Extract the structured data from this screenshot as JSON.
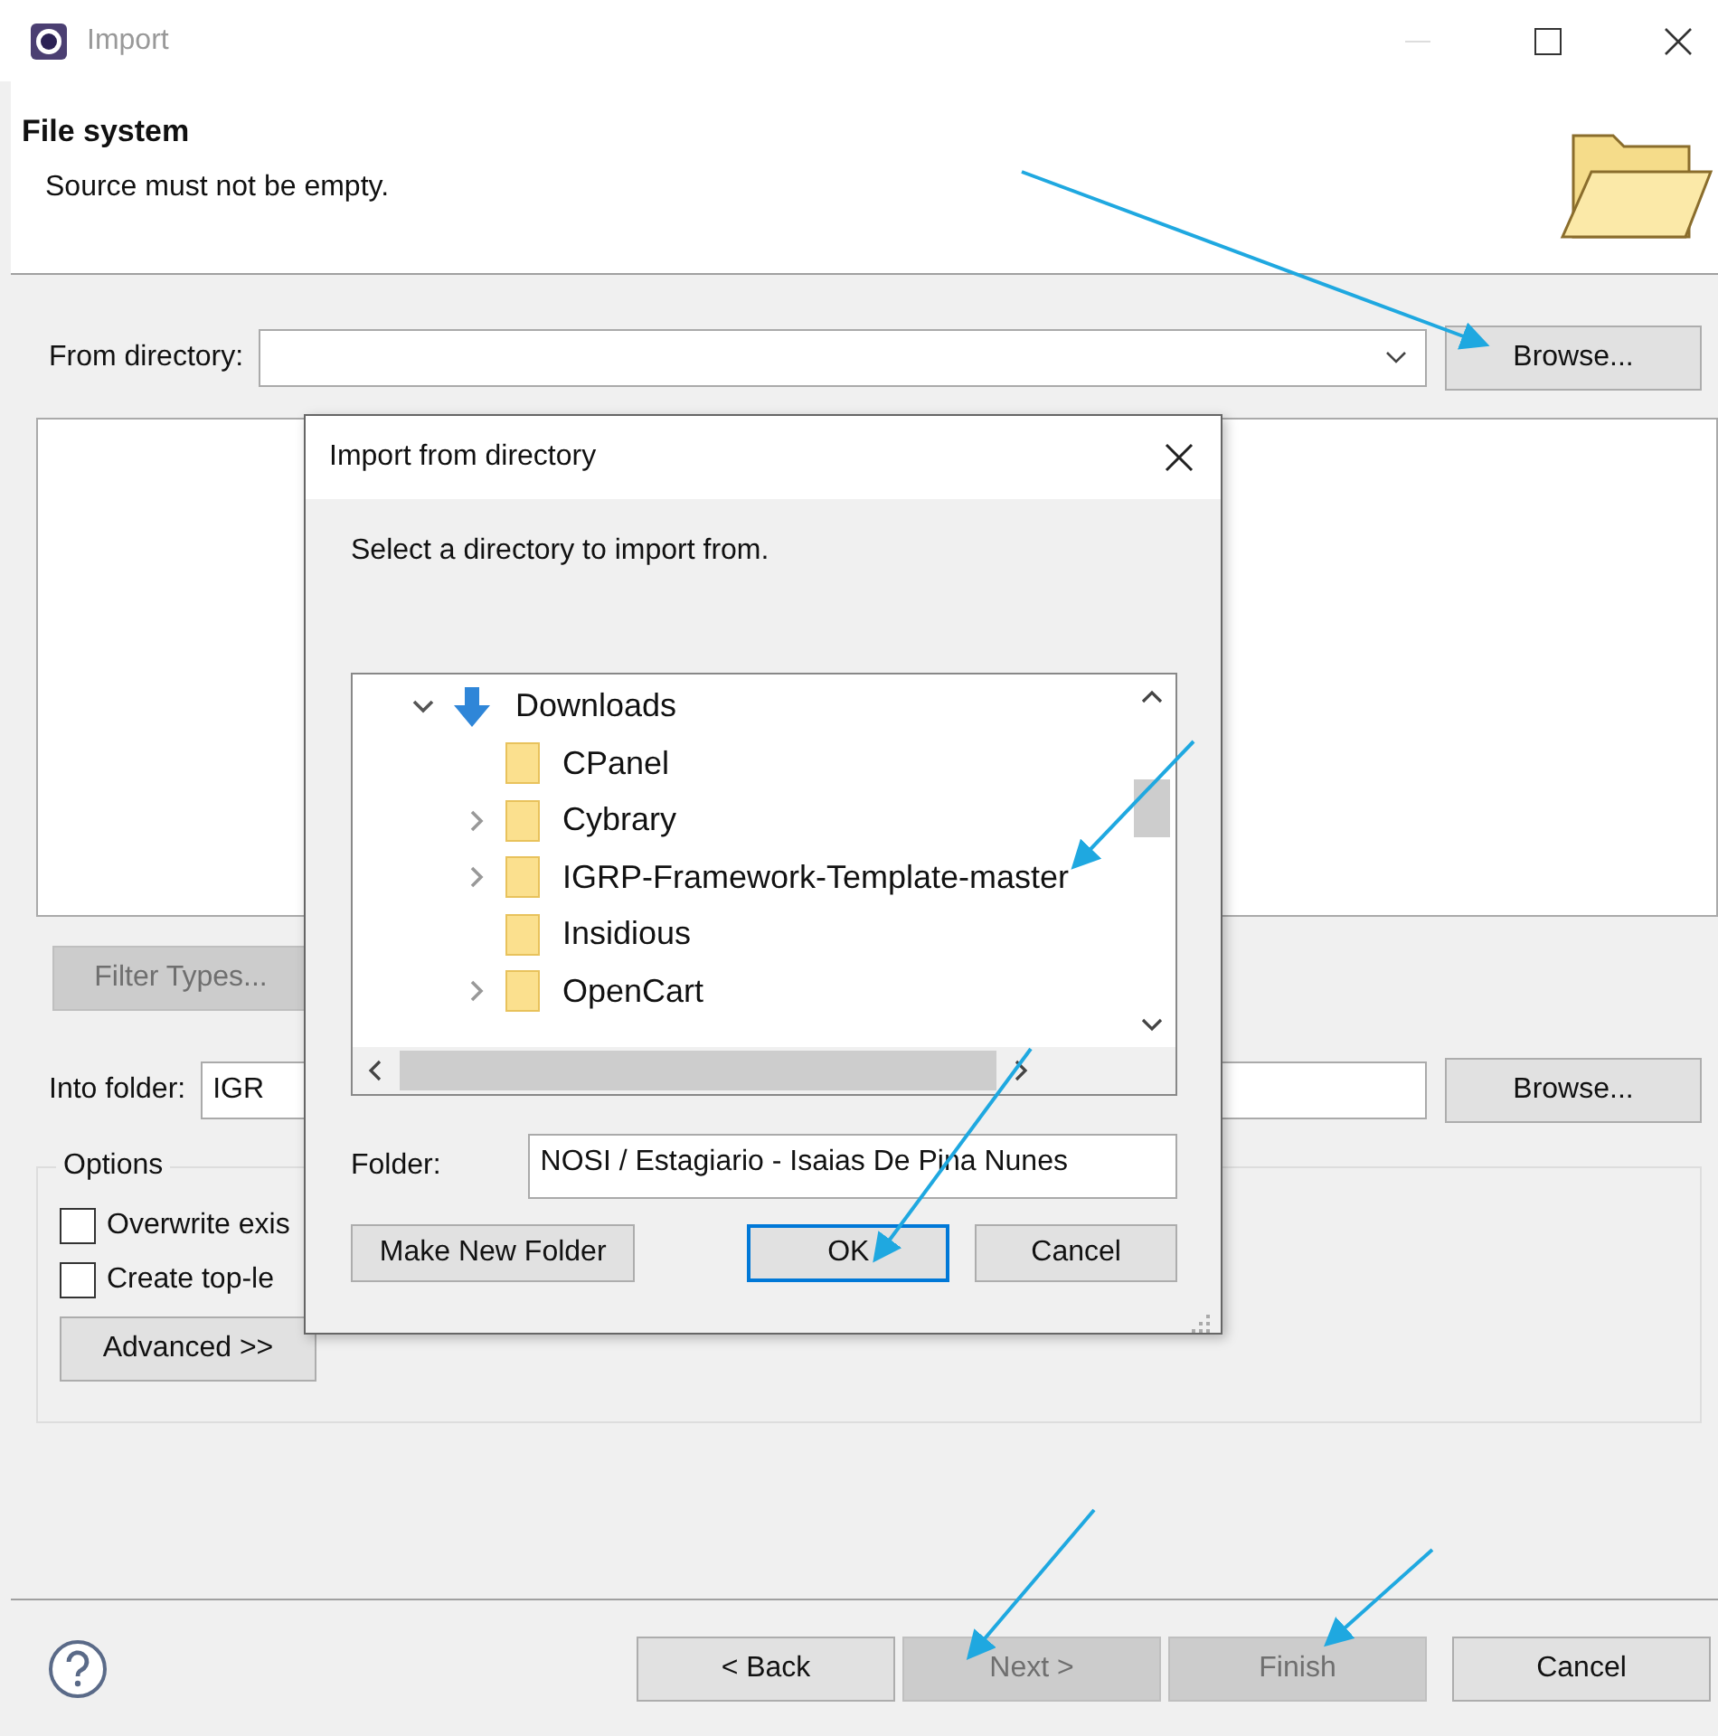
{
  "window": {
    "title": "Import"
  },
  "header": {
    "title": "File system",
    "message": "Source must not be empty."
  },
  "from_directory": {
    "label": "From directory:",
    "browse": "Browse..."
  },
  "filter_button": {
    "label": "Filter Types...",
    "disabled": true
  },
  "into_folder": {
    "label": "Into folder:",
    "value": "IGR",
    "browse": "Browse..."
  },
  "options": {
    "title": "Options",
    "checkboxes": [
      {
        "label": "Overwrite exis",
        "checked": false
      },
      {
        "label": "Create top-le",
        "checked": false
      }
    ],
    "advanced": "Advanced >>"
  },
  "buttons": [
    {
      "label": "< Back",
      "disabled": false
    },
    {
      "label": "Next >",
      "disabled": true
    },
    {
      "label": "Finish",
      "disabled": true
    },
    {
      "label": "Cancel",
      "disabled": false
    }
  ],
  "dialog": {
    "title": "Import from directory",
    "prompt": "Select a directory to import from.",
    "tree": [
      {
        "name": "Downloads",
        "kind": "download",
        "expanded": true,
        "children": [
          {
            "name": "CPanel",
            "kind": "folder",
            "expandable": false
          },
          {
            "name": "Cybrary",
            "kind": "folder",
            "expandable": true
          },
          {
            "name": "IGRP-Framework-Template-master",
            "kind": "folder",
            "expandable": true
          },
          {
            "name": "Insidious",
            "kind": "folder",
            "expandable": false
          },
          {
            "name": "OpenCart",
            "kind": "folder",
            "expandable": true
          }
        ]
      }
    ],
    "folder_label": "Folder:",
    "folder_value": "NOSI / Estagiario - Isaias De Pina Nunes",
    "buttons": [
      {
        "label": "Make New Folder",
        "default": false
      },
      {
        "label": "OK",
        "default": true
      },
      {
        "label": "Cancel",
        "default": false
      }
    ]
  }
}
